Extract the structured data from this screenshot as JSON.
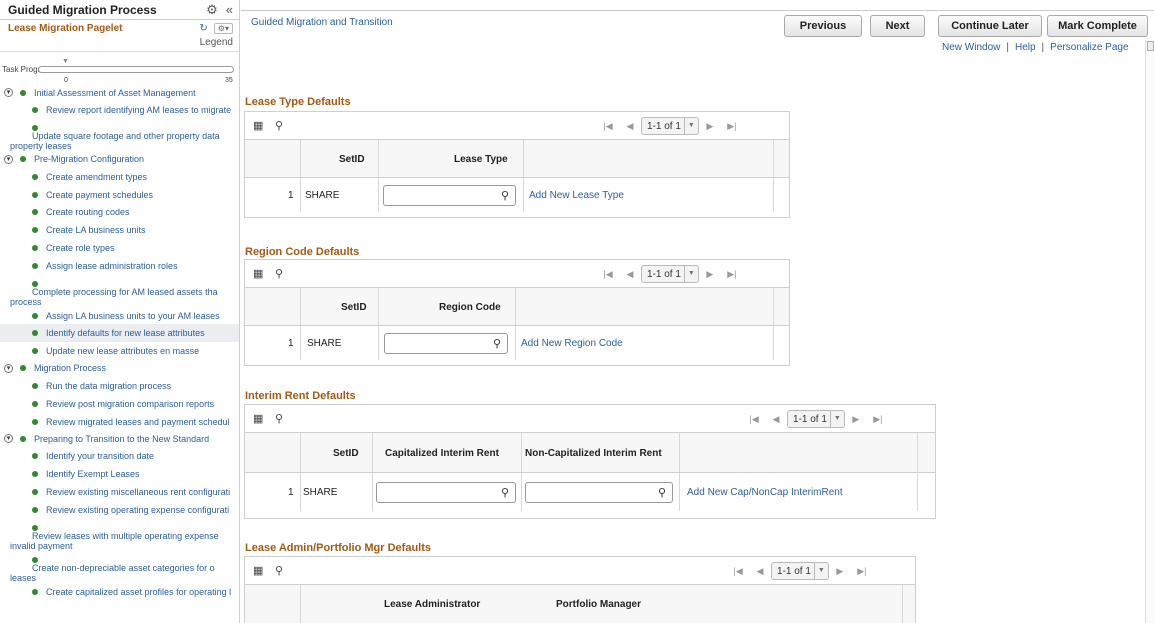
{
  "left": {
    "title": "Guided Migration Process",
    "gear_icon": "gear-icon",
    "collapse_icon": "double-chevron-left-icon",
    "pagelet_title": "Lease Migration Pagelet",
    "refresh_icon": "refresh-icon",
    "options_icon": "gear-dropdown-icon",
    "legend_label": "Legend",
    "progress": {
      "label": "Task Progress",
      "min": "0",
      "max": "35",
      "value": 0
    },
    "sections": [
      {
        "label": "Initial Assessment of Asset Management",
        "tasks": [
          {
            "label": "Review report identifying AM leases to migrate",
            "lines": 1
          },
          {
            "label": "Update square footage and other property data",
            "cont": "property leases",
            "lines": 2
          }
        ]
      },
      {
        "label": "Pre-Migration Configuration",
        "tasks": [
          {
            "label": "Create amendment types",
            "lines": 1
          },
          {
            "label": "Create payment schedules",
            "lines": 1
          },
          {
            "label": "Create routing codes",
            "lines": 1
          },
          {
            "label": "Create LA business units",
            "lines": 1
          },
          {
            "label": "Create role types",
            "lines": 1
          },
          {
            "label": "Assign lease administration roles",
            "lines": 1
          },
          {
            "label": "Complete processing for AM leased assets tha",
            "cont": "process",
            "lines": 2
          },
          {
            "label": "Assign LA business units to your AM leases",
            "lines": 1
          },
          {
            "label": "Identify defaults for new lease attributes",
            "lines": 1,
            "active": true
          },
          {
            "label": "Update new lease attributes en masse",
            "lines": 1
          }
        ]
      },
      {
        "label": "Migration Process",
        "tasks": [
          {
            "label": "Run the data migration process",
            "lines": 1
          },
          {
            "label": "Review post migration comparison reports",
            "lines": 1
          },
          {
            "label": "Review migrated leases and payment schedul",
            "lines": 1
          }
        ]
      },
      {
        "label": "Preparing to Transition to the New Standard",
        "tasks": [
          {
            "label": "Identify your transition date",
            "lines": 1
          },
          {
            "label": "Identify Exempt Leases",
            "lines": 1
          },
          {
            "label": "Review existing miscellaneous rent configurati",
            "lines": 1
          },
          {
            "label": "Review existing operating expense configurati",
            "lines": 1
          },
          {
            "label": "Review leases with multiple operating expense",
            "cont": "invalid payment",
            "lines": 2
          },
          {
            "label": "Create non-depreciable asset categories for o",
            "cont": "leases",
            "lines": 2
          },
          {
            "label": "Create capitalized asset profiles for operating l",
            "lines": 1
          }
        ]
      }
    ]
  },
  "right": {
    "breadcrumb": "Guided Migration and Transition",
    "buttons": {
      "previous": "Previous",
      "next": "Next",
      "continue_later": "Continue Later",
      "mark_complete": "Mark Complete"
    },
    "links": {
      "new_window": "New Window",
      "help": "Help",
      "personalize": "Personalize Page",
      "sep": "|"
    },
    "toolbar_icons": {
      "personalize": "grid-personalize-icon",
      "find": "search-icon"
    },
    "pager": {
      "first": "first-page-icon",
      "prev": "previous-page-icon",
      "next": "next-page-icon",
      "last": "last-page-icon",
      "dropdown": "chevron-down-icon"
    },
    "grids": [
      {
        "title": "Lease Type Defaults",
        "count": "1-1 of 1",
        "headers": [
          "SetID",
          "Lease Type"
        ],
        "row": {
          "num": "1",
          "setid": "SHARE",
          "add_link": "Add New Lease Type"
        }
      },
      {
        "title": "Region Code Defaults",
        "count": "1-1 of 1",
        "headers": [
          "SetID",
          "Region Code"
        ],
        "row": {
          "num": "1",
          "setid": "SHARE",
          "add_link": "Add New Region Code"
        }
      },
      {
        "title": "Interim Rent Defaults",
        "count": "1-1 of 1",
        "headers": [
          "SetID",
          "Capitalized Interim Rent",
          "Non-Capitalized Interim Rent"
        ],
        "row": {
          "num": "1",
          "setid": "SHARE",
          "add_link": "Add New Cap/NonCap InterimRent"
        }
      },
      {
        "title": "Lease Admin/Portfolio Mgr Defaults",
        "count": "1-1 of 1",
        "headers": [
          "Lease Administrator",
          "Portfolio Manager"
        ]
      }
    ]
  }
}
